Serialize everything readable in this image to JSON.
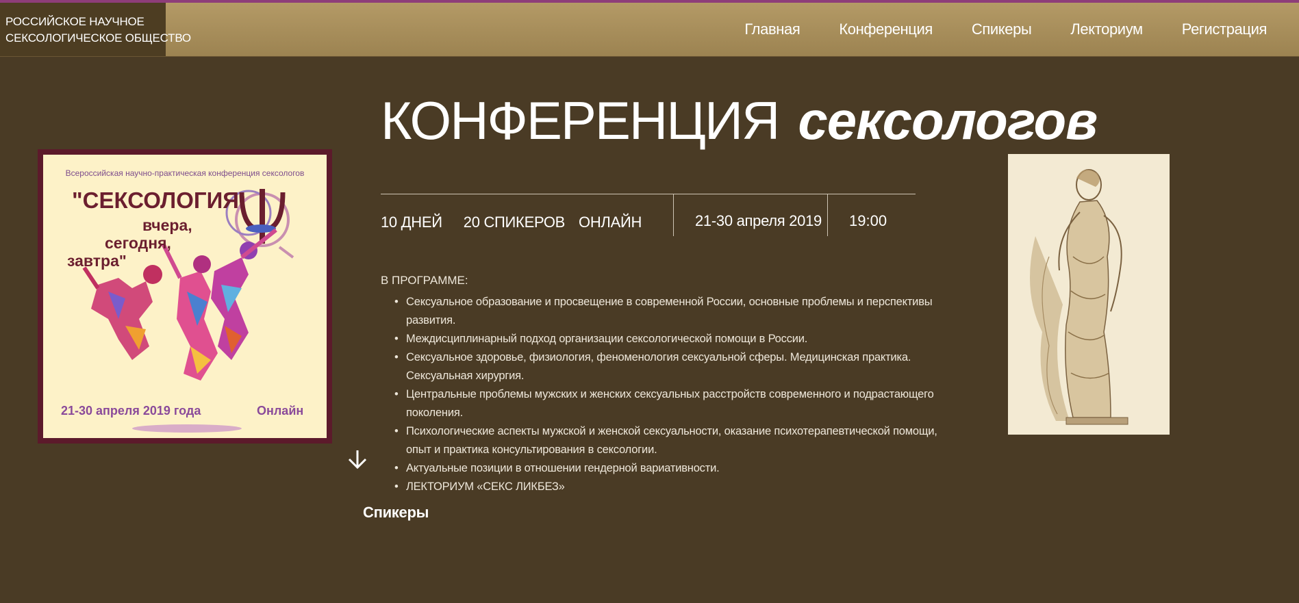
{
  "header": {
    "logo_line1": "РОССИЙСКОЕ НАУЧНОЕ",
    "logo_line2": "СЕКСОЛОГИЧЕСКОЕ ОБЩЕСТВО",
    "nav": [
      {
        "label": "Главная"
      },
      {
        "label": "Конференция"
      },
      {
        "label": "Спикеры"
      },
      {
        "label": "Лекториум"
      },
      {
        "label": "Регистрация"
      }
    ]
  },
  "poster": {
    "subtitle": "Всероссийская научно-практическая конференция сексологов",
    "title_line1": "\"СЕКСОЛОГИЯ:",
    "title_line2": "вчера,",
    "title_line3": "сегодня,",
    "title_line4": "завтра\"",
    "date": "21-30 апреля 2019 года",
    "format": "Онлайн"
  },
  "main": {
    "title_caps": "КОНФЕРЕНЦИЯ",
    "title_italic": "сексологов",
    "facts": [
      "10 ДНЕЙ",
      "20 СПИКЕРОВ",
      "ОНЛАЙН"
    ],
    "dates": "21-30 апреля 2019",
    "time": "19:00",
    "program_title": "В ПРОГРАММЕ:",
    "program": [
      "Сексуальное образование и просвещение в современной России, основные проблемы и перспективы развития.",
      "Междисциплинарный подход организации сексологической помощи в России.",
      "Сексуальное здоровье, физиология, феноменология сексуальной сферы. Медицинская практика. Сексуальная хирургия.",
      "Центральные проблемы мужских и женских сексуальных расстройств современного и подрастающего поколения.",
      "Психологические аспекты мужской и женской сексуальности, оказание психотерапевтической помощи, опыт и практика консультирования в сексологии.",
      "Актуальные позиции в отношении гендерной вариативности.",
      "ЛЕКТОРИУМ «СЕКС ЛИКБЕЗ»"
    ],
    "speakers_heading": "Спикеры"
  },
  "colors": {
    "background": "#4a3b25",
    "header": "#b49a66",
    "logo_bg": "#4d3d22",
    "accent_line": "#8e3d79",
    "poster_border": "#5c1a2b"
  }
}
